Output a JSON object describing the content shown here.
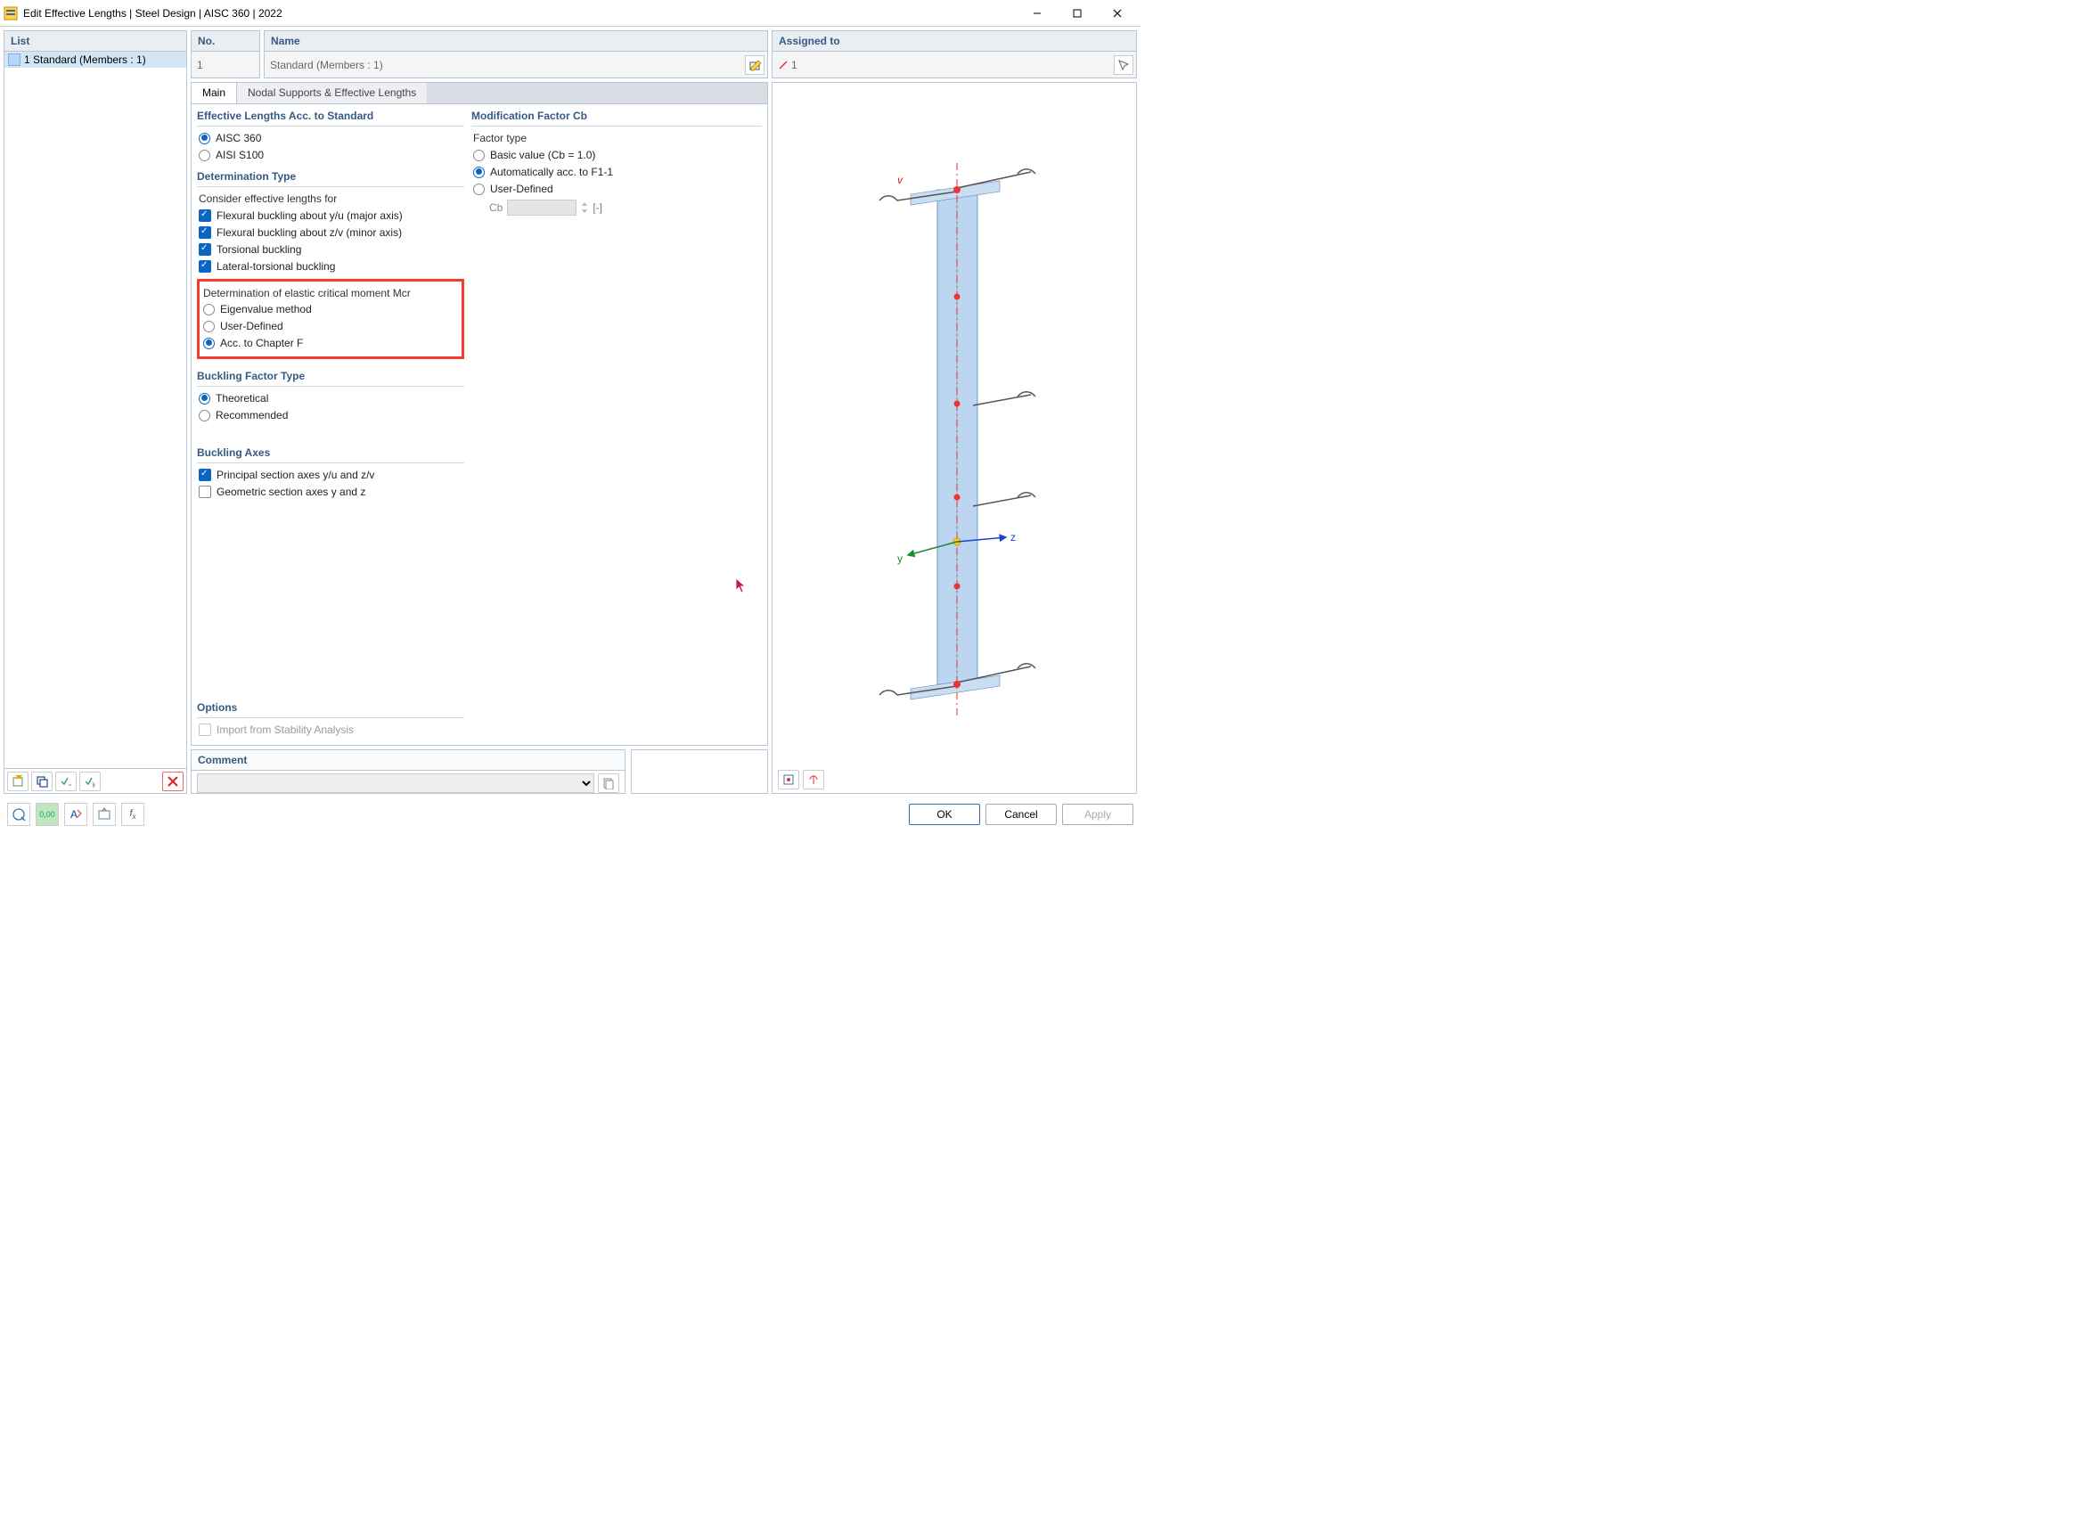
{
  "window": {
    "title": "Edit Effective Lengths | Steel Design | AISC 360 | 2022"
  },
  "sidebar": {
    "header": "List",
    "item": "1 Standard (Members : 1)"
  },
  "toprow": {
    "no_header": "No.",
    "no_value": "1",
    "name_header": "Name",
    "name_value": "Standard (Members : 1)",
    "assigned_header": "Assigned to",
    "assigned_value": "1"
  },
  "tabs": {
    "main": "Main",
    "nodal": "Nodal Supports & Effective Lengths"
  },
  "groups": {
    "eff_len": {
      "title": "Effective Lengths Acc. to Standard",
      "aisc360": "AISC 360",
      "aisis100": "AISI S100"
    },
    "det_type": {
      "title": "Determination Type",
      "subhead": "Consider effective lengths for",
      "c1": "Flexural buckling about y/u (major axis)",
      "c2": "Flexural buckling about z/v (minor axis)",
      "c3": "Torsional buckling",
      "c4": "Lateral-torsional buckling",
      "mcr_sub": "Determination of elastic critical moment Mcr",
      "r_eigen": "Eigenvalue method",
      "r_user": "User-Defined",
      "r_chapf": "Acc. to Chapter F"
    },
    "buck_factor": {
      "title": "Buckling Factor Type",
      "r_theo": "Theoretical",
      "r_rec": "Recommended"
    },
    "buck_axes": {
      "title": "Buckling Axes",
      "c_princ": "Principal section axes y/u and z/v",
      "c_geom": "Geometric section axes y and z"
    },
    "options": {
      "title": "Options",
      "c_import": "Import from Stability Analysis"
    },
    "cb": {
      "title": "Modification Factor Cb",
      "subhead": "Factor type",
      "r_basic": "Basic value (Cb = 1.0)",
      "r_auto": "Automatically acc. to F1-1",
      "r_user": "User-Defined",
      "cb_label": "Cb",
      "cb_unit": "[-]"
    }
  },
  "comment": {
    "title": "Comment"
  },
  "footer": {
    "ok": "OK",
    "cancel": "Cancel",
    "apply": "Apply"
  }
}
